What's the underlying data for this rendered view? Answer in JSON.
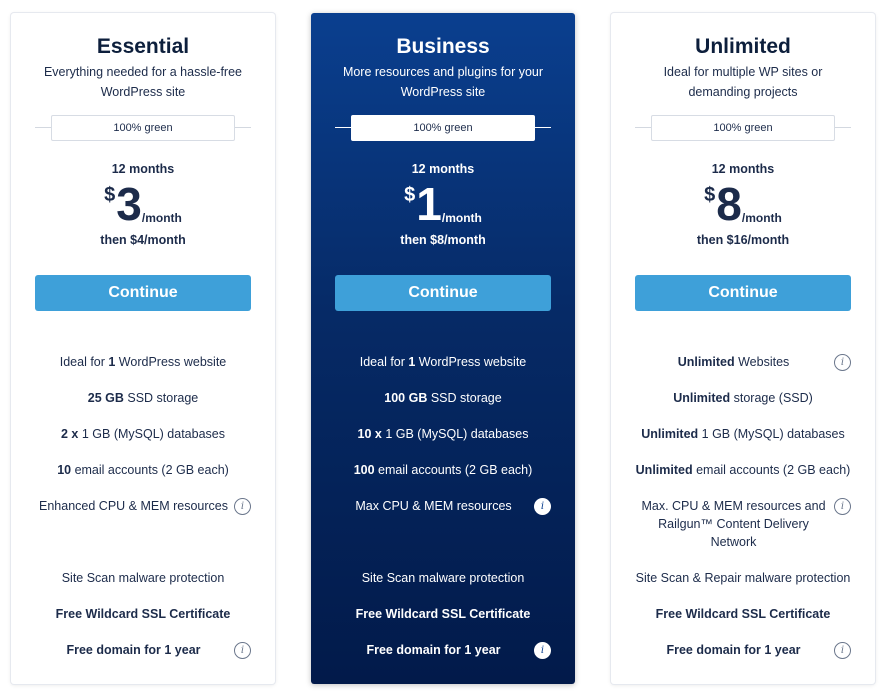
{
  "plans": [
    {
      "name": "Essential",
      "description": "Everything needed for a hassle-free WordPress site",
      "badge": "100% green",
      "term": "12 months",
      "currency": "$",
      "price": "3",
      "per": "/month",
      "then": "then $4/month",
      "cta": "Continue",
      "features": [
        {
          "bold": "",
          "pre": "Ideal for ",
          "mid": "1",
          "post": " WordPress website",
          "info": false
        },
        {
          "bold": "25 GB",
          "rest": " SSD storage",
          "info": false
        },
        {
          "bold": "2 x",
          "rest": " 1 GB (MySQL) databases",
          "info": false
        },
        {
          "bold": "10",
          "rest": " email accounts (2 GB each)",
          "info": false
        },
        {
          "bold": "",
          "rest": "Enhanced CPU & MEM resources",
          "info": true
        },
        {
          "bold": "",
          "rest": "Site Scan malware protection",
          "info": false
        },
        {
          "bold": "Free Wildcard SSL Certificate",
          "rest": "",
          "info": false
        },
        {
          "bold": "Free domain for 1 year",
          "rest": "",
          "info": true
        }
      ]
    },
    {
      "name": "Business",
      "description": "More resources and plugins for your WordPress site",
      "badge": "100% green",
      "term": "12 months",
      "currency": "$",
      "price": "1",
      "per": "/month",
      "then": "then $8/month",
      "cta": "Continue",
      "features": [
        {
          "bold": "",
          "pre": "Ideal for ",
          "mid": "1",
          "post": " WordPress website",
          "info": false
        },
        {
          "bold": "100 GB",
          "rest": " SSD storage",
          "info": false
        },
        {
          "bold": "10 x",
          "rest": " 1 GB (MySQL) databases",
          "info": false
        },
        {
          "bold": "100",
          "rest": " email accounts (2 GB each)",
          "info": false
        },
        {
          "bold": "",
          "rest": "Max CPU & MEM resources",
          "info": true
        },
        {
          "bold": "",
          "rest": "Site Scan malware protection",
          "info": false
        },
        {
          "bold": "Free Wildcard SSL Certificate",
          "rest": "",
          "info": false
        },
        {
          "bold": "Free domain for 1 year",
          "rest": "",
          "info": true
        }
      ]
    },
    {
      "name": "Unlimited",
      "description": "Ideal for multiple WP sites or demanding projects",
      "badge": "100% green",
      "term": "12 months",
      "currency": "$",
      "price": "8",
      "per": "/month",
      "then": "then $16/month",
      "cta": "Continue",
      "features": [
        {
          "bold": "Unlimited",
          "rest": " Websites",
          "info": true
        },
        {
          "bold": "Unlimited",
          "rest": " storage (SSD)",
          "info": false
        },
        {
          "bold": "Unlimited",
          "rest": " 1 GB (MySQL) databases",
          "info": false
        },
        {
          "bold": "Unlimited",
          "rest": " email accounts (2 GB each)",
          "info": false
        },
        {
          "bold": "",
          "rest": "Max. CPU & MEM resources and Railgun™ Content Delivery Network",
          "info": true
        },
        {
          "bold": "",
          "rest": "Site Scan & Repair malware protection",
          "info": false
        },
        {
          "bold": "Free Wildcard SSL Certificate",
          "rest": "",
          "info": false
        },
        {
          "bold": "Free domain for 1 year",
          "rest": "",
          "info": true
        }
      ]
    }
  ],
  "info_icon_glyph": "i",
  "colors": {
    "featured_top": "#0a3f8f",
    "featured_bottom": "#021a4a",
    "cta": "#3ea0d9",
    "text": "#1c2b4a"
  }
}
